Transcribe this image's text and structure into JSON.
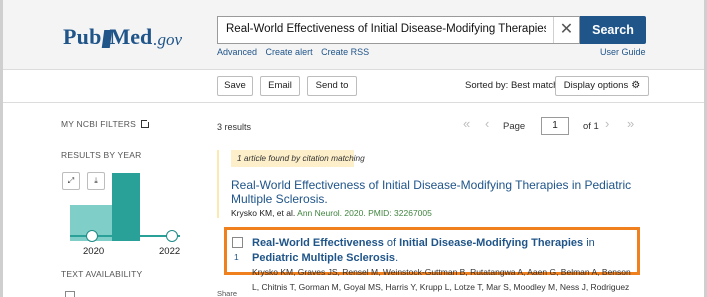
{
  "header": {
    "logo": {
      "pub": "Pub",
      "m": "Med",
      "gov": ".gov"
    },
    "search": {
      "query": "Real-World Effectiveness of Initial Disease-Modifying Therapies in Pediatric Multiple Sclerosis",
      "clear_icon": "close-icon",
      "button_label": "Search"
    },
    "links": [
      "Advanced",
      "Create alert",
      "Create RSS"
    ],
    "user_guide": "User Guide"
  },
  "toolbar": {
    "save": "Save",
    "email": "Email",
    "send_to": "Send to",
    "sorted_by": "Sorted by: Best match",
    "display_options": "Display options",
    "display_icon": "gear-icon"
  },
  "sidebar": {
    "ncbi_filters": "MY NCBI FILTERS",
    "results_by_year": "RESULTS BY YEAR",
    "expand_icon": "expand-icon",
    "download_icon": "download-icon",
    "year_start": "2020",
    "year_end": "2022",
    "text_availability": "TEXT AVAILABILITY",
    "bar_chart": {
      "bar_color": "#2aa198",
      "bar_color_light": "#7fcfc8"
    }
  },
  "results": {
    "count": "3 results",
    "pager": {
      "label": "Page",
      "current": "1",
      "of": "of 1"
    },
    "citation_note": "1 article found by citation matching",
    "first": {
      "title": "Real-World Effectiveness of Initial Disease-Modifying Therapies in Pediatric Multiple Sclerosis.",
      "authors": "Krysko KM, et al.",
      "journal": "Ann Neurol. 2020.",
      "pmid": "PMID: 32267005"
    },
    "second": {
      "number": "1",
      "title_parts": [
        {
          "text": "Real-World Effectiveness",
          "bold": true
        },
        {
          "text": " of ",
          "bold": false
        },
        {
          "text": "Initial Disease-Modifying Therapies",
          "bold": true
        },
        {
          "text": " in ",
          "bold": false
        },
        {
          "text": "Pediatric Multiple Sclerosis",
          "bold": true
        },
        {
          "text": ".",
          "bold": false
        }
      ],
      "authors_line1": "Krysko KM, Graves JS, Rensel M, Weinstock-Guttman B, Rutatangwa A, Aaen G, Belman A, Benson",
      "authors_line2": "L, Chitnis T, Gorman M, Goyal MS, Harris Y, Krupp L, Lotze T, Mar S, Moodley M, Ness J, Rodriguez",
      "share": "Share"
    },
    "highlight_color": "#f07f1e"
  }
}
